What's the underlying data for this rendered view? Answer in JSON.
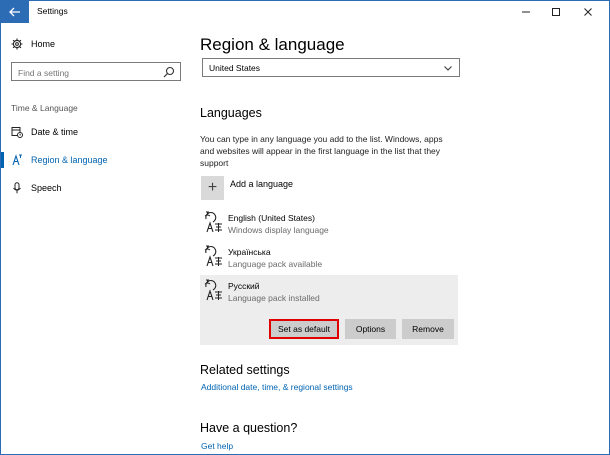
{
  "window": {
    "title": "Settings"
  },
  "sidebar": {
    "home_label": "Home",
    "search_placeholder": "Find a setting",
    "section_label": "Time & Language",
    "items": [
      {
        "label": "Date & time",
        "icon": "calendar-clock-icon"
      },
      {
        "label": "Region & language",
        "icon": "region-language-icon",
        "active": true
      },
      {
        "label": "Speech",
        "icon": "microphone-icon"
      }
    ]
  },
  "main": {
    "title": "Region & language",
    "country": {
      "value": "United States"
    },
    "languages": {
      "heading": "Languages",
      "description": "You can type in any language you add to the list. Windows, apps and websites will appear in the first language in the list that they support",
      "add_label": "Add a language",
      "items": [
        {
          "name": "English (United States)",
          "status": "Windows display language"
        },
        {
          "name": "Українська",
          "status": "Language pack available"
        },
        {
          "name": "Русский",
          "status": "Language pack installed",
          "selected": true
        }
      ],
      "buttons": {
        "set_default": "Set as default",
        "options": "Options",
        "remove": "Remove"
      }
    },
    "related": {
      "heading": "Related settings",
      "link": "Additional date, time, & regional settings"
    },
    "question": {
      "heading": "Have a question?",
      "link": "Get help"
    }
  },
  "colors": {
    "accent": "#0063b1",
    "titlebar_back": "#2b6cb5",
    "highlight_border": "#e00000",
    "selected_bg": "#ededed",
    "button_bg": "#cccccc"
  }
}
